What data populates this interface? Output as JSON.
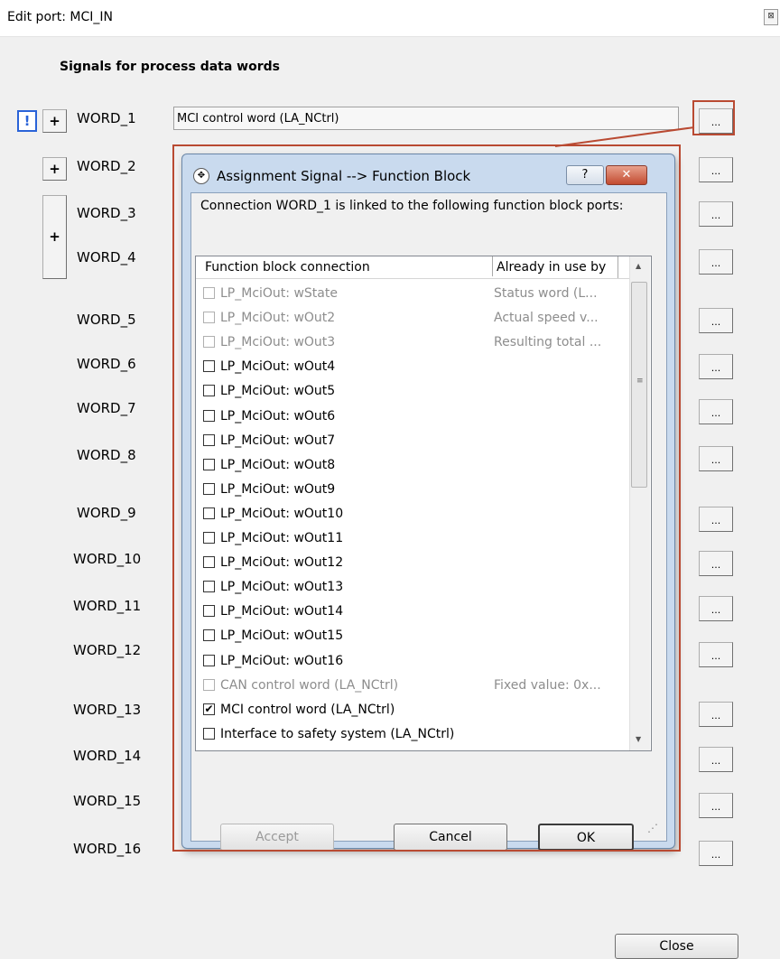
{
  "window": {
    "title": "Edit port: MCI_IN",
    "close_icon": "close-icon"
  },
  "heading": "Signals for process data words",
  "warning_icon_text": "!",
  "plus_label": "+",
  "words": [
    {
      "label": "WORD_1"
    },
    {
      "label": "WORD_2"
    },
    {
      "label": "WORD_3"
    },
    {
      "label": "WORD_4"
    },
    {
      "label": "WORD_5"
    },
    {
      "label": "WORD_6"
    },
    {
      "label": "WORD_7"
    },
    {
      "label": "WORD_8"
    },
    {
      "label": "WORD_9"
    },
    {
      "label": "WORD_10"
    },
    {
      "label": "WORD_11"
    },
    {
      "label": "WORD_12"
    },
    {
      "label": "WORD_13"
    },
    {
      "label": "WORD_14"
    },
    {
      "label": "WORD_15"
    },
    {
      "label": "WORD_16"
    }
  ],
  "word1_value": "MCI control word (LA_NCtrl)",
  "dots_label": "...",
  "close_button": "Close",
  "dialog": {
    "title": "Assignment Signal --> Function Block",
    "help_label": "?",
    "close_label": "✕",
    "message": "Connection WORD_1 is linked to the following function block ports:",
    "col_connection": "Function block connection",
    "col_in_use": "Already in use by",
    "items": [
      {
        "label": "LP_MciOut: wState",
        "in_use": "Status word (L...",
        "checked": false,
        "disabled": true
      },
      {
        "label": "LP_MciOut: wOut2",
        "in_use": "Actual speed v...",
        "checked": false,
        "disabled": true
      },
      {
        "label": "LP_MciOut: wOut3",
        "in_use": "Resulting total ...",
        "checked": false,
        "disabled": true
      },
      {
        "label": "LP_MciOut: wOut4",
        "in_use": "",
        "checked": false,
        "disabled": false
      },
      {
        "label": "LP_MciOut: wOut5",
        "in_use": "",
        "checked": false,
        "disabled": false
      },
      {
        "label": "LP_MciOut: wOut6",
        "in_use": "",
        "checked": false,
        "disabled": false
      },
      {
        "label": "LP_MciOut: wOut7",
        "in_use": "",
        "checked": false,
        "disabled": false
      },
      {
        "label": "LP_MciOut: wOut8",
        "in_use": "",
        "checked": false,
        "disabled": false
      },
      {
        "label": "LP_MciOut: wOut9",
        "in_use": "",
        "checked": false,
        "disabled": false
      },
      {
        "label": "LP_MciOut: wOut10",
        "in_use": "",
        "checked": false,
        "disabled": false
      },
      {
        "label": "LP_MciOut: wOut11",
        "in_use": "",
        "checked": false,
        "disabled": false
      },
      {
        "label": "LP_MciOut: wOut12",
        "in_use": "",
        "checked": false,
        "disabled": false
      },
      {
        "label": "LP_MciOut: wOut13",
        "in_use": "",
        "checked": false,
        "disabled": false
      },
      {
        "label": "LP_MciOut: wOut14",
        "in_use": "",
        "checked": false,
        "disabled": false
      },
      {
        "label": "LP_MciOut: wOut15",
        "in_use": "",
        "checked": false,
        "disabled": false
      },
      {
        "label": "LP_MciOut: wOut16",
        "in_use": "",
        "checked": false,
        "disabled": false
      },
      {
        "label": "CAN control word (LA_NCtrl)",
        "in_use": "Fixed value: 0x...",
        "checked": false,
        "disabled": true
      },
      {
        "label": "MCI control word (LA_NCtrl)",
        "in_use": "",
        "checked": true,
        "disabled": false
      },
      {
        "label": "Interface to safety system (LA_NCtrl)",
        "in_use": "",
        "checked": false,
        "disabled": false
      }
    ],
    "accept_button": "Accept",
    "cancel_button": "Cancel",
    "ok_button": "OK"
  },
  "colors": {
    "highlight": "#b94a32",
    "warning": "#2a63d8"
  }
}
